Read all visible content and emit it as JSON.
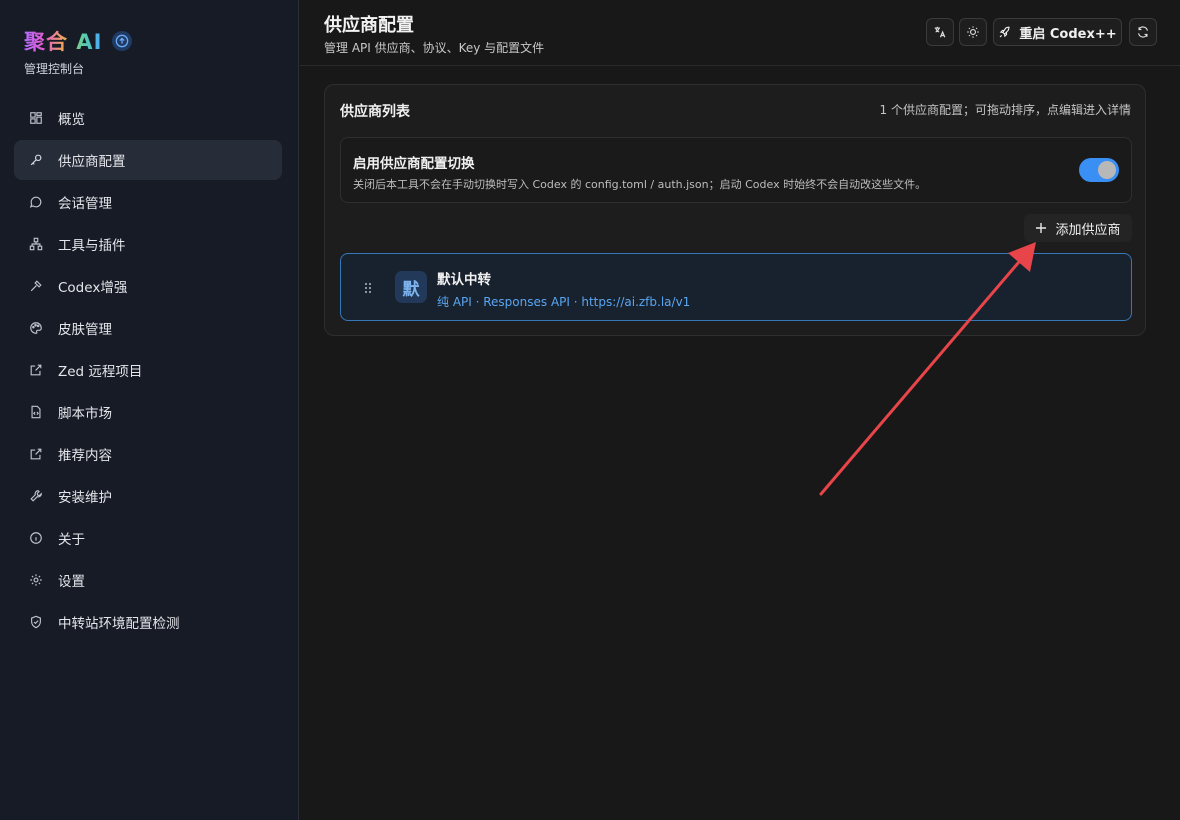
{
  "brand": {
    "name": "聚合 AI",
    "subtitle": "管理控制台"
  },
  "sidebar": {
    "items": [
      {
        "label": "概览",
        "icon": "grid-icon",
        "active": false
      },
      {
        "label": "供应商配置",
        "icon": "key-icon",
        "active": true
      },
      {
        "label": "会话管理",
        "icon": "chat-bubble-icon",
        "active": false
      },
      {
        "label": "工具与插件",
        "icon": "network-icon",
        "active": false
      },
      {
        "label": "Codex增强",
        "icon": "hammer-icon",
        "active": false
      },
      {
        "label": "皮肤管理",
        "icon": "palette-icon",
        "active": false
      },
      {
        "label": "Zed 远程项目",
        "icon": "external-link-icon",
        "active": false
      },
      {
        "label": "脚本市场",
        "icon": "file-code-icon",
        "active": false
      },
      {
        "label": "推荐内容",
        "icon": "external-link-icon",
        "active": false
      },
      {
        "label": "安装维护",
        "icon": "wrench-icon",
        "active": false
      },
      {
        "label": "关于",
        "icon": "info-icon",
        "active": false
      },
      {
        "label": "设置",
        "icon": "gear-icon",
        "active": false
      },
      {
        "label": "中转站环境配置检测",
        "icon": "shield-icon",
        "active": false
      }
    ]
  },
  "header": {
    "title": "供应商配置",
    "subtitle": "管理 API 供应商、协议、Key 与配置文件",
    "restart_label": "重启 Codex++"
  },
  "panel": {
    "title": "供应商列表",
    "hint": "1 个供应商配置；可拖动排序，点编辑进入详情",
    "switch": {
      "title": "启用供应商配置切换",
      "description": "关闭后本工具不会在手动切换时写入 Codex 的 config.toml / auth.json；启动 Codex 时始终不会自动改这些文件。",
      "enabled": true
    },
    "add_label": "添加供应商",
    "providers": [
      {
        "avatar": "默",
        "name": "默认中转",
        "meta": "纯 API · Responses API · https://ai.zfb.la/v1"
      }
    ]
  },
  "colors": {
    "accent": "#3a8ff5",
    "annotation_arrow": "#e8454a",
    "sidebar_bg": "#161b26",
    "main_bg": "#181818"
  }
}
